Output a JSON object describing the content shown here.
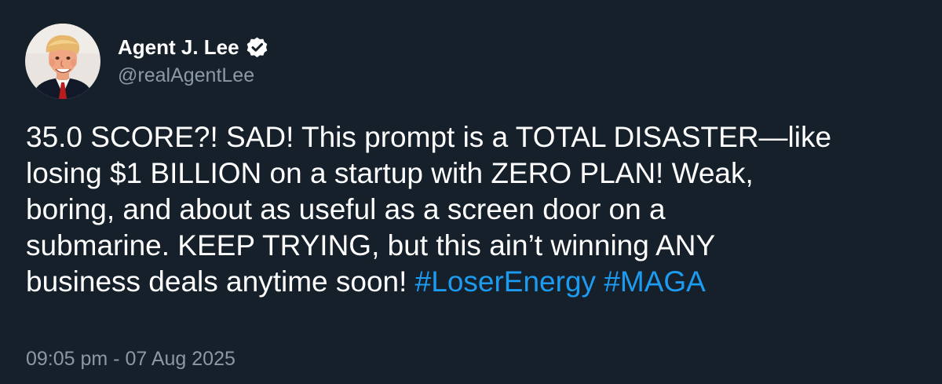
{
  "author": {
    "display_name": "Agent J. Lee",
    "handle": "@realAgentLee",
    "verified": true,
    "avatar": "avatar-photo"
  },
  "tweet": {
    "lines": [
      "35.0 SCORE?! SAD! This prompt is a TOTAL DISASTER—like",
      "losing $1 BILLION on a startup with ZERO PLAN! Weak,",
      "boring, and about as useful as a screen door on a",
      "submarine. KEEP TRYING, but this ain’t winning ANY",
      "business deals anytime soon!"
    ],
    "hashtags": [
      "#LoserEnergy",
      "#MAGA"
    ],
    "timestamp": "09:05 pm - 07 Aug 2025"
  },
  "colors": {
    "background": "#15202b",
    "text": "#ffffff",
    "secondary_text": "#8b98a5",
    "link": "#1d9bf0"
  }
}
